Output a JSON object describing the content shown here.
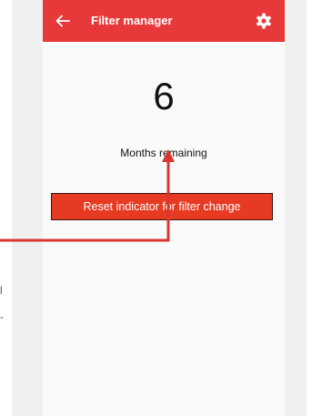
{
  "app_bar": {
    "title": "Filter manager",
    "back_icon": "arrow-left-icon",
    "settings_icon": "gear-icon",
    "background_color": "#e8393a"
  },
  "filter": {
    "months_remaining": "6",
    "months_remaining_label": "Months remaining",
    "reset_button_label": "Reset indicator for filter change",
    "reset_button_color": "#e63a22"
  },
  "annotation": {
    "arrow_color": "#d9362f",
    "cut_text_1": "l",
    "cut_text_2": "-"
  }
}
